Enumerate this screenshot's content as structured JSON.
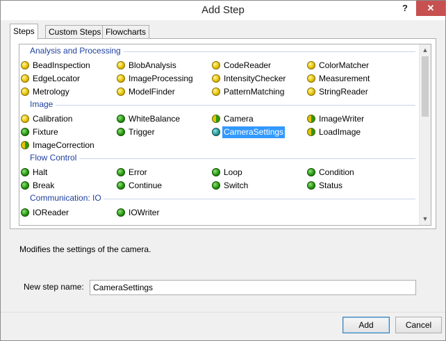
{
  "window": {
    "title": "Add Step",
    "help_glyph": "?",
    "close_glyph": "✕"
  },
  "tabs": [
    {
      "label": "Steps",
      "active": true
    },
    {
      "label": "Custom Steps",
      "active": false
    },
    {
      "label": "Flowcharts",
      "active": false
    }
  ],
  "groups": [
    {
      "name": "Analysis and Processing",
      "items": [
        {
          "label": "BeadInspection",
          "color": "yellow"
        },
        {
          "label": "BlobAnalysis",
          "color": "yellow"
        },
        {
          "label": "CodeReader",
          "color": "yellow"
        },
        {
          "label": "ColorMatcher",
          "color": "yellow"
        },
        {
          "label": "EdgeLocator",
          "color": "yellow"
        },
        {
          "label": "ImageProcessing",
          "color": "yellow"
        },
        {
          "label": "IntensityChecker",
          "color": "yellow"
        },
        {
          "label": "Measurement",
          "color": "yellow"
        },
        {
          "label": "Metrology",
          "color": "yellow"
        },
        {
          "label": "ModelFinder",
          "color": "yellow"
        },
        {
          "label": "PatternMatching",
          "color": "yellow"
        },
        {
          "label": "StringReader",
          "color": "yellow"
        }
      ]
    },
    {
      "name": "Image",
      "items": [
        {
          "label": "Calibration",
          "color": "yellow"
        },
        {
          "label": "WhiteBalance",
          "color": "green"
        },
        {
          "label": "Camera",
          "color": "split"
        },
        {
          "label": "ImageWriter",
          "color": "split"
        },
        {
          "label": "Fixture",
          "color": "green"
        },
        {
          "label": "Trigger",
          "color": "green"
        },
        {
          "label": "CameraSettings",
          "color": "teal",
          "selected": true
        },
        {
          "label": "LoadImage",
          "color": "split"
        },
        {
          "label": "ImageCorrection",
          "color": "split"
        }
      ]
    },
    {
      "name": "Flow Control",
      "items": [
        {
          "label": "Halt",
          "color": "green"
        },
        {
          "label": "Error",
          "color": "green"
        },
        {
          "label": "Loop",
          "color": "green"
        },
        {
          "label": "Condition",
          "color": "green"
        },
        {
          "label": "Break",
          "color": "green"
        },
        {
          "label": "Continue",
          "color": "green"
        },
        {
          "label": "Switch",
          "color": "green"
        },
        {
          "label": "Status",
          "color": "green"
        }
      ]
    },
    {
      "name": "Communication: IO",
      "items": [
        {
          "label": "IOReader",
          "color": "green"
        },
        {
          "label": "IOWriter",
          "color": "green"
        }
      ]
    }
  ],
  "scrollbar": {
    "up_glyph": "▲",
    "down_glyph": "▼",
    "position": 0.0
  },
  "description": "Modifies the settings of the camera.",
  "name_field": {
    "label": "New step name:",
    "value": "CameraSettings"
  },
  "buttons": {
    "add": "Add",
    "cancel": "Cancel"
  }
}
